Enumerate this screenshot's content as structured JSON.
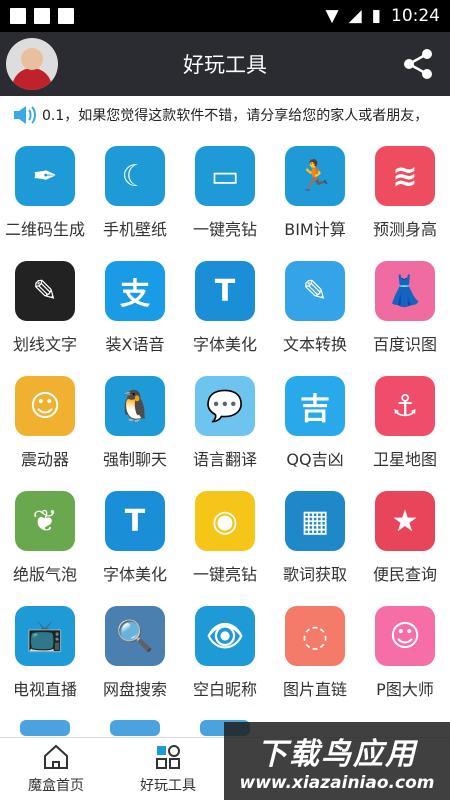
{
  "status": {
    "time": "10:24"
  },
  "header": {
    "title": "好玩工具"
  },
  "marquee": {
    "text": "0.1，如果您觉得这款软件不错，请分享给您的家人或者朋友，"
  },
  "tools": [
    {
      "label": "二维码生成",
      "icon": "feather-pen-icon",
      "color": "#1e9ad6",
      "glyph": "✒"
    },
    {
      "label": "手机壁纸",
      "icon": "moon-star-icon",
      "color": "#1e9ad6",
      "glyph": "☾"
    },
    {
      "label": "一键亮钻",
      "icon": "id-card-icon",
      "color": "#1e9ad6",
      "glyph": "▭"
    },
    {
      "label": "BIM计算",
      "icon": "running-man-icon",
      "color": "#1e9ad6",
      "glyph": "🏃"
    },
    {
      "label": "预测身高",
      "icon": "layers-icon",
      "color": "#ee4d5f",
      "glyph": "≋"
    },
    {
      "label": "划线文字",
      "icon": "notepad-pen-icon",
      "color": "#222222",
      "glyph": "✎"
    },
    {
      "label": "装X语音",
      "icon": "alipay-icon",
      "color": "#1a9be6",
      "glyph": "支"
    },
    {
      "label": "字体美化",
      "icon": "font-T-icon",
      "color": "#1a8fd8",
      "glyph": "T"
    },
    {
      "label": "文本转换",
      "icon": "edit-pen-icon",
      "color": "#35a3e8",
      "glyph": "✎"
    },
    {
      "label": "百度识图",
      "icon": "dress-icon",
      "color": "#f06ba0",
      "glyph": "👗"
    },
    {
      "label": "震动器",
      "icon": "glasses-face-icon",
      "color": "#f0b030",
      "glyph": "☺"
    },
    {
      "label": "强制聊天",
      "icon": "qq-penguin-icon",
      "color": "#1e9ad6",
      "glyph": "🐧"
    },
    {
      "label": "语言翻译",
      "icon": "chat-bubble-icon",
      "color": "#6cc4ef",
      "glyph": "💬"
    },
    {
      "label": "QQ吉凶",
      "icon": "qq-luck-icon",
      "color": "#29a8ea",
      "glyph": "吉"
    },
    {
      "label": "卫星地图",
      "icon": "anchor-icon",
      "color": "#f04d6a",
      "glyph": "⚓"
    },
    {
      "label": "绝版气泡",
      "icon": "bubble-machine-icon",
      "color": "#6aa84f",
      "glyph": "❦"
    },
    {
      "label": "字体美化",
      "icon": "font-T-icon",
      "color": "#1a8fd8",
      "glyph": "T"
    },
    {
      "label": "一键亮钻",
      "icon": "gold-coin-icon",
      "color": "#f5c518",
      "glyph": "◉"
    },
    {
      "label": "歌词获取",
      "icon": "grid-blocks-icon",
      "color": "#1e88c8",
      "glyph": "▦"
    },
    {
      "label": "便民查询",
      "icon": "bookmark-star-icon",
      "color": "#e8445a",
      "glyph": "★"
    },
    {
      "label": "电视直播",
      "icon": "tv-icon",
      "color": "#1e9ad6",
      "glyph": "📺"
    },
    {
      "label": "网盘搜索",
      "icon": "magnifier-icon",
      "color": "#4a7fb0",
      "glyph": "🔍"
    },
    {
      "label": "空白昵称",
      "icon": "eye-icon",
      "color": "#1e9ad6",
      "glyph": "👁"
    },
    {
      "label": "图片直链",
      "icon": "link-circle-icon",
      "color": "#f47a6a",
      "glyph": "◌"
    },
    {
      "label": "P图大师",
      "icon": "smile-bubble-icon",
      "color": "#f56fa6",
      "glyph": "☺"
    }
  ],
  "tabs": [
    {
      "label": "魔盒首页",
      "icon": "home-icon"
    },
    {
      "label": "好玩工具",
      "icon": "apps-grid-icon"
    }
  ],
  "watermark": {
    "line1": "下载鸟应用",
    "line2": "www.xiazainiao.com"
  }
}
